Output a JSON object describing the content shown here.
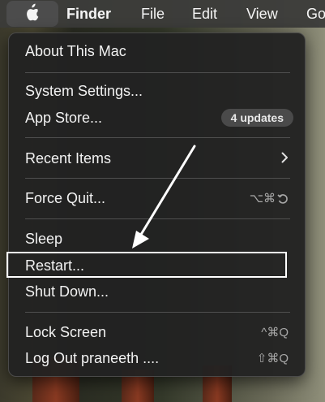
{
  "menubar": {
    "apple_icon": "apple-logo-icon",
    "finder": "Finder",
    "file": "File",
    "edit": "Edit",
    "view": "View",
    "go": "Go"
  },
  "menu": {
    "about": "About This Mac",
    "settings": "System Settings...",
    "appstore": "App Store...",
    "appstore_badge": "4 updates",
    "recent": "Recent Items",
    "forcequit": "Force Quit...",
    "forcequit_shortcut": "⌥⌘",
    "sleep": "Sleep",
    "restart": "Restart...",
    "shutdown": "Shut Down...",
    "lock": "Lock Screen",
    "lock_shortcut": "^⌘Q",
    "logout": "Log Out praneeth ....",
    "logout_shortcut": "⇧⌘Q"
  },
  "annotation": {
    "arrow_color": "#ffffff",
    "box_color": "#ffffff"
  }
}
